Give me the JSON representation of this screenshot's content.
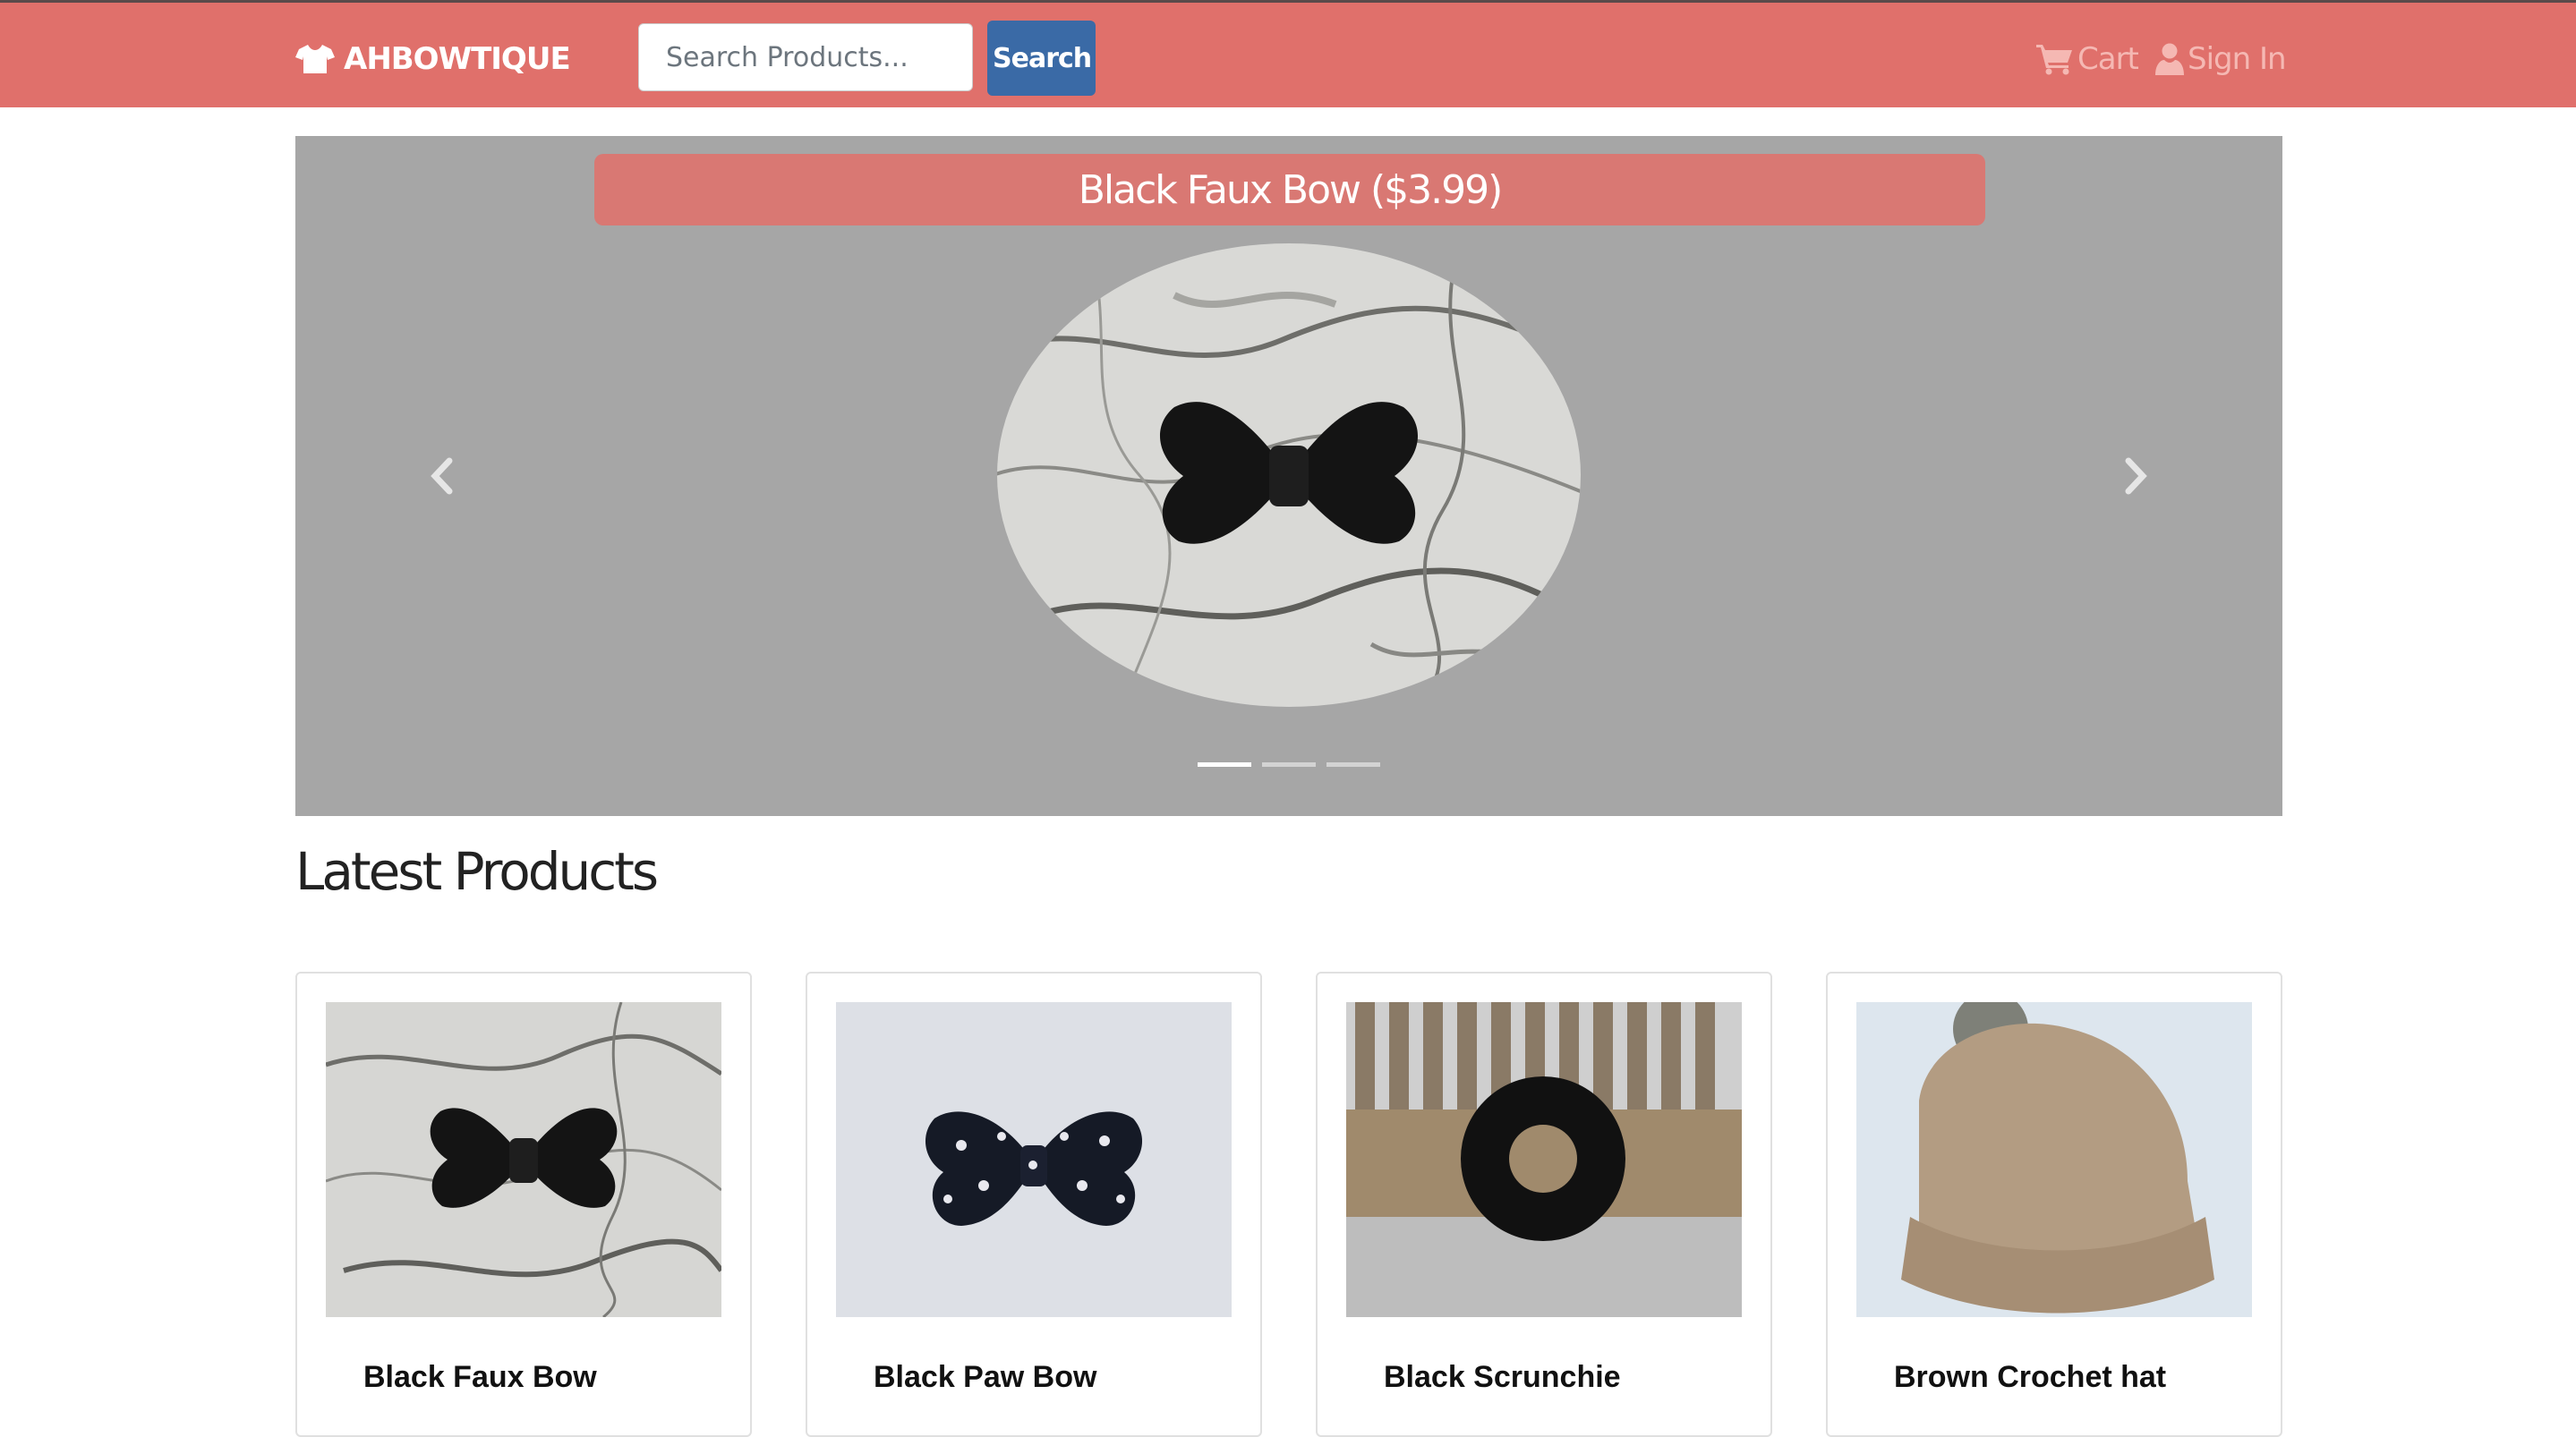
{
  "navbar": {
    "brand": "AHBOWTIQUE",
    "search_placeholder": "Search Products...",
    "search_button": "Search",
    "cart_label": "Cart",
    "signin_label": "Sign In",
    "colors": {
      "bar": "#e0706b",
      "button": "#3a6aa6",
      "links": "#f5b8b3"
    },
    "icons": [
      "tshirt-icon",
      "cart-icon",
      "user-icon"
    ]
  },
  "carousel": {
    "caption": "Black Faux Bow ($3.99)",
    "active_slide": 1,
    "slide_count": 3
  },
  "section": {
    "title": "Latest Products"
  },
  "products": [
    {
      "name": "Black Faux Bow"
    },
    {
      "name": "Black Paw Bow"
    },
    {
      "name": "Black Scrunchie"
    },
    {
      "name": "Brown Crochet hat"
    }
  ]
}
